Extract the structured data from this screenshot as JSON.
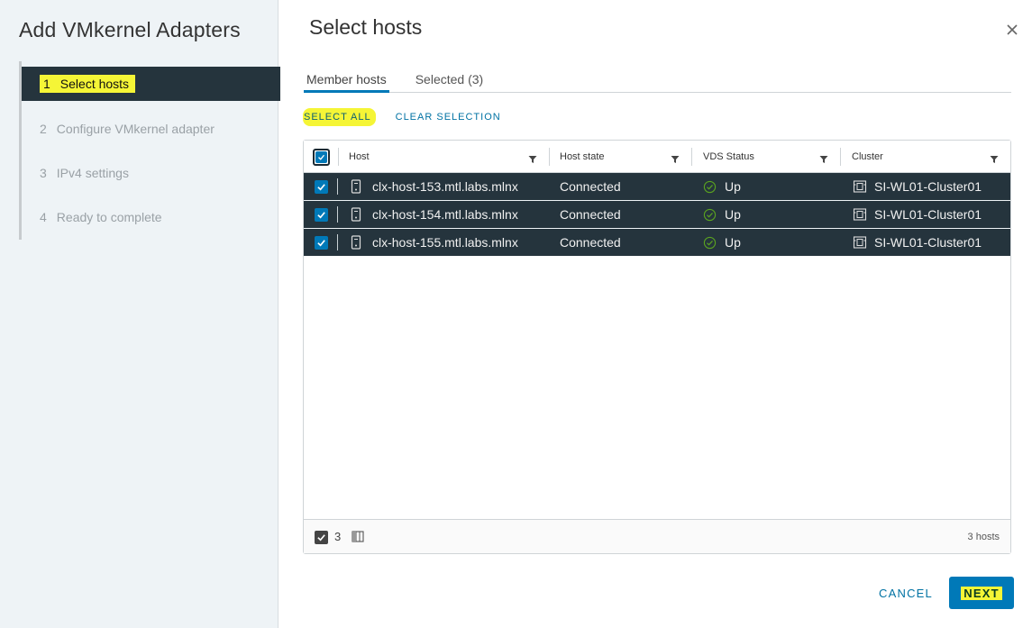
{
  "wizard": {
    "title": "Add VMkernel Adapters",
    "steps": [
      {
        "num": "1",
        "label": "Select hosts",
        "active": true
      },
      {
        "num": "2",
        "label": "Configure VMkernel adapter",
        "active": false
      },
      {
        "num": "3",
        "label": "IPv4 settings",
        "active": false
      },
      {
        "num": "4",
        "label": "Ready to complete",
        "active": false
      }
    ]
  },
  "page": {
    "title": "Select hosts",
    "close_icon": "close-icon"
  },
  "tabs": [
    {
      "label": "Member hosts",
      "active": true
    },
    {
      "label": "Selected (3)",
      "active": false
    }
  ],
  "actions": {
    "select_all": "SELECT ALL",
    "clear_selection": "CLEAR SELECTION"
  },
  "grid": {
    "columns": [
      "Host",
      "Host state",
      "VDS Status",
      "Cluster"
    ],
    "rows": [
      {
        "host": "clx-host-153.mtl.labs.mlnx",
        "state": "Connected",
        "vds": "Up",
        "cluster": "SI-WL01-Cluster01",
        "checked": true
      },
      {
        "host": "clx-host-154.mtl.labs.mlnx",
        "state": "Connected",
        "vds": "Up",
        "cluster": "SI-WL01-Cluster01",
        "checked": true
      },
      {
        "host": "clx-host-155.mtl.labs.mlnx",
        "state": "Connected",
        "vds": "Up",
        "cluster": "SI-WL01-Cluster01",
        "checked": true
      }
    ],
    "footer": {
      "selected_count": "3",
      "total": "3 hosts"
    }
  },
  "buttons": {
    "cancel": "CANCEL",
    "next": "NEXT"
  },
  "colors": {
    "accent": "#0079b8",
    "nav_active": "#25343d",
    "highlight": "#f5f536",
    "status_ok": "#5aa220"
  }
}
